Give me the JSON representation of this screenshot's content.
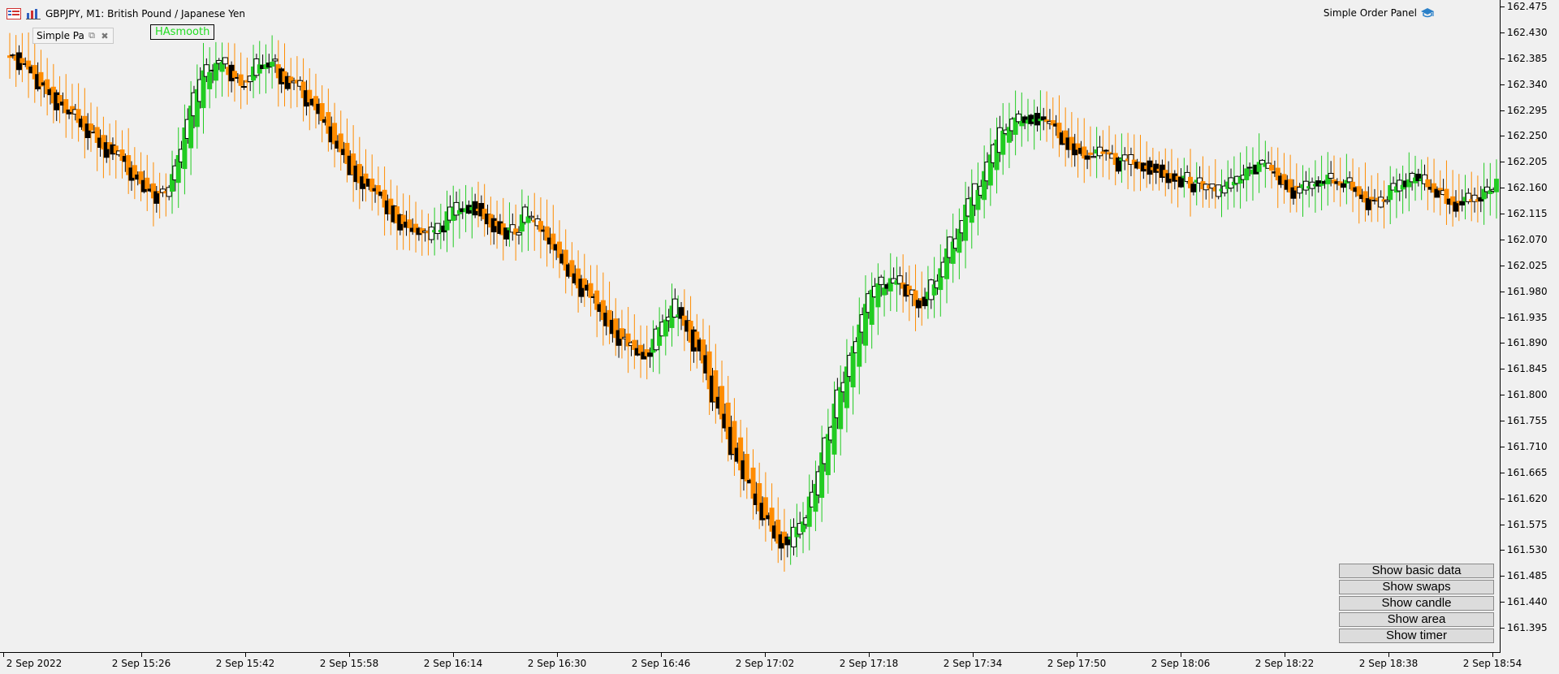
{
  "header": {
    "symbol_text": "GBPJPY, M1:  British Pound / Japanese Yen",
    "mini_panel_label": "Simple Pa",
    "indicator_label": "HAsmooth",
    "order_panel_label": "Simple Order Panel"
  },
  "icons": {
    "symbol_list": "list-icon",
    "chart_type": "chart-icon",
    "restore": "restore-icon",
    "close": "close-icon",
    "order_panel": "graduation-cap-icon"
  },
  "buttons": {
    "basic_data": "Show basic data",
    "swaps": "Show swaps",
    "candle": "Show candle",
    "area": "Show area",
    "timer": "Show timer"
  },
  "colors": {
    "up_trend": "#22cc22",
    "down_trend": "#ff8c00",
    "candle_outline": "#000000",
    "background": "#f0f0f0"
  },
  "chart_data": {
    "type": "candlestick",
    "symbol": "GBPJPY",
    "timeframe": "M1",
    "price_ticks": [
      "162.475",
      "162.430",
      "162.385",
      "162.340",
      "162.295",
      "162.250",
      "162.205",
      "162.160",
      "162.115",
      "162.070",
      "162.025",
      "161.980",
      "161.935",
      "161.890",
      "161.845",
      "161.800",
      "161.755",
      "161.710",
      "161.665",
      "161.620",
      "161.575",
      "161.530",
      "161.485",
      "161.440",
      "161.395"
    ],
    "time_ticks": [
      "2 Sep 2022",
      "2 Sep 15:26",
      "2 Sep 15:42",
      "2 Sep 15:58",
      "2 Sep 16:14",
      "2 Sep 16:30",
      "2 Sep 16:46",
      "2 Sep 17:02",
      "2 Sep 17:18",
      "2 Sep 17:34",
      "2 Sep 17:50",
      "2 Sep 18:06",
      "2 Sep 18:22",
      "2 Sep 18:38",
      "2 Sep 18:54"
    ],
    "ylim": [
      161.372,
      162.48
    ],
    "price_path": [
      162.39,
      162.37,
      162.345,
      162.32,
      162.3,
      162.28,
      162.255,
      162.24,
      162.22,
      162.2,
      162.175,
      162.15,
      162.15,
      162.2,
      162.28,
      162.35,
      162.38,
      162.37,
      162.34,
      162.36,
      162.38,
      162.37,
      162.34,
      162.33,
      162.3,
      162.26,
      162.23,
      162.2,
      162.17,
      162.15,
      162.13,
      162.1,
      162.085,
      162.075,
      162.09,
      162.11,
      162.13,
      162.13,
      162.11,
      162.09,
      162.08,
      162.11,
      162.09,
      162.06,
      162.03,
      162.0,
      161.97,
      161.94,
      161.91,
      161.89,
      161.87,
      161.88,
      161.93,
      161.95,
      161.91,
      161.87,
      161.8,
      161.74,
      161.68,
      161.63,
      161.59,
      161.56,
      161.54,
      161.57,
      161.63,
      161.72,
      161.8,
      161.87,
      161.94,
      161.99,
      162.0,
      161.99,
      161.97,
      161.96,
      162.01,
      162.06,
      162.11,
      162.15,
      162.2,
      162.25,
      162.28,
      162.29,
      162.28,
      162.27,
      162.25,
      162.23,
      162.21,
      162.22,
      162.21,
      162.2,
      162.205,
      162.2,
      162.19,
      162.18,
      162.17,
      162.16,
      162.15,
      162.16,
      162.18,
      162.2,
      162.195,
      162.18,
      162.16,
      162.15,
      162.17,
      162.18,
      162.17,
      162.16,
      162.14,
      162.13,
      162.15,
      162.17,
      162.18,
      162.165,
      162.15,
      162.14,
      162.13,
      162.14,
      162.16,
      162.17
    ]
  }
}
